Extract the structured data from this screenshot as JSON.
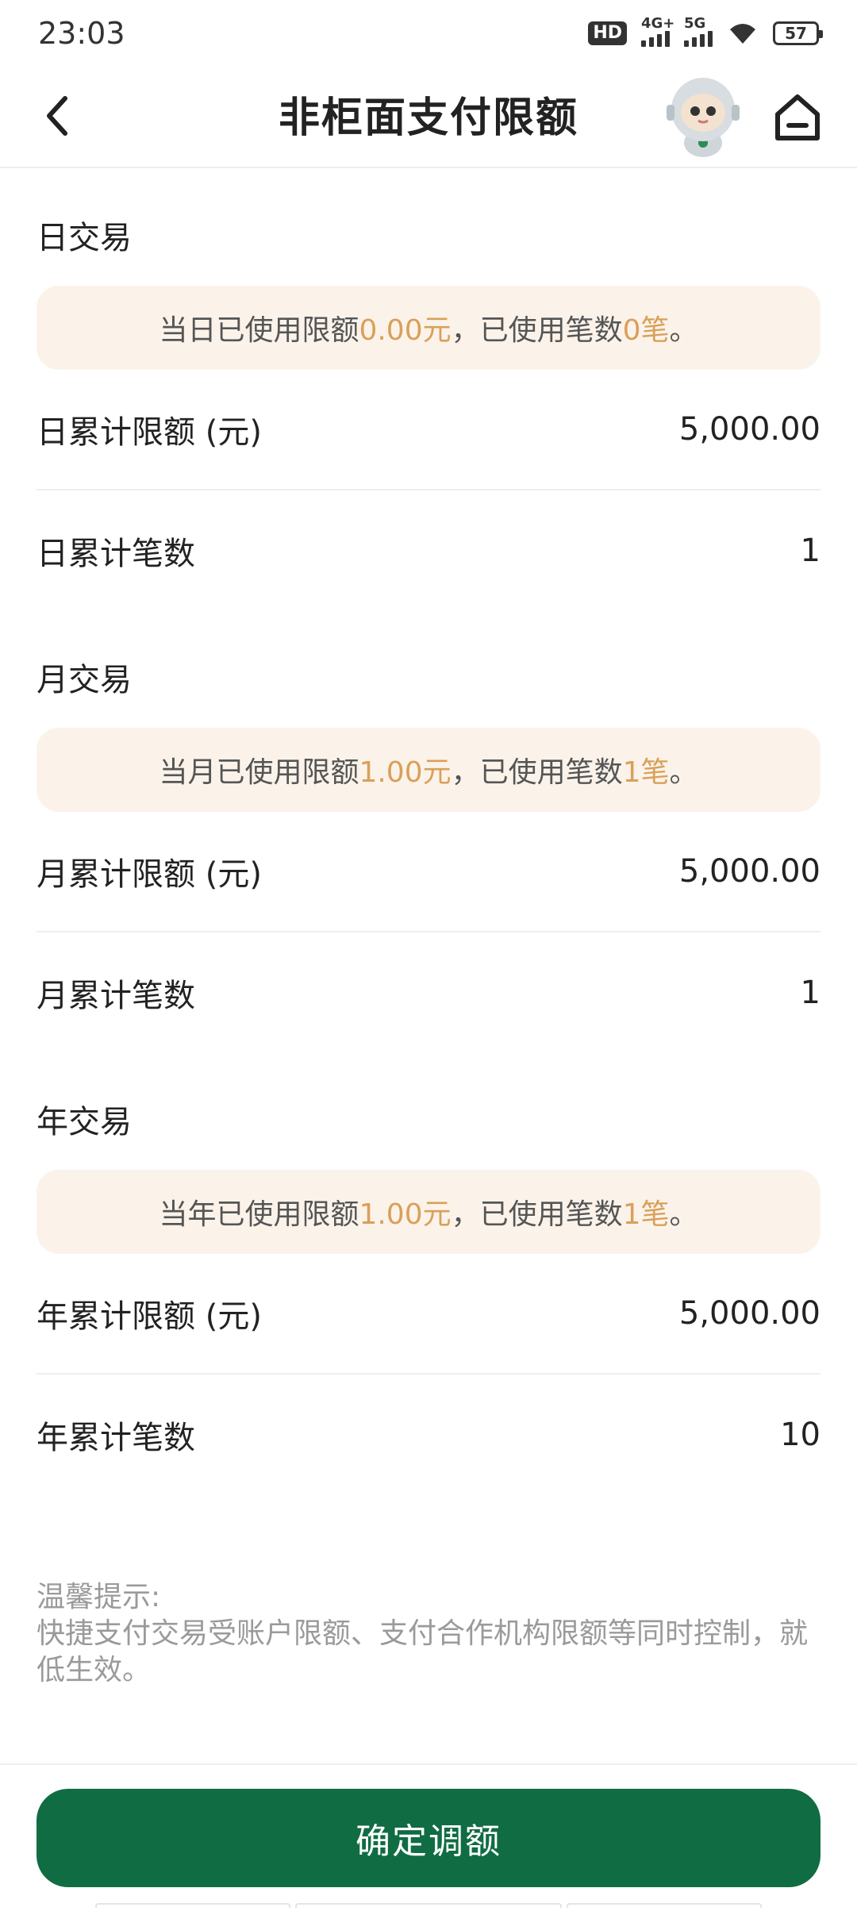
{
  "status_bar": {
    "time": "23:03",
    "hd_label": "HD",
    "sim1_label": "4G+",
    "sim2_label": "5G",
    "battery": "57"
  },
  "nav": {
    "title": "非柜面支付限额",
    "icons": [
      "back-arrow-icon",
      "robot-assistant-icon",
      "home-icon"
    ]
  },
  "day": {
    "title": "日交易",
    "notice_prefix": "当日已使用限额",
    "notice_amount": "0.00元",
    "notice_mid": "，已使用笔数",
    "notice_count": "0笔",
    "notice_suffix": "。",
    "limit_label": "日累计限额 (元)",
    "limit_value": "5,000.00",
    "count_label": "日累计笔数",
    "count_value": "1"
  },
  "month": {
    "title": "月交易",
    "notice_prefix": "当月已使用限额",
    "notice_amount": "1.00元",
    "notice_mid": "，已使用笔数",
    "notice_count": "1笔",
    "notice_suffix": "。",
    "limit_label": "月累计限额 (元)",
    "limit_value": "5,000.00",
    "count_label": "月累计笔数",
    "count_value": "1"
  },
  "year": {
    "title": "年交易",
    "notice_prefix": "当年已使用限额",
    "notice_amount": "1.00元",
    "notice_mid": "，已使用笔数",
    "notice_count": "1笔",
    "notice_suffix": "。",
    "limit_label": "年累计限额 (元)",
    "limit_value": "5,000.00",
    "count_label": "年累计笔数",
    "count_value": "10"
  },
  "tips": {
    "title": "温馨提示:",
    "body": "快捷支付交易受账户限额、支付合作机构限额等同时控制，就低生效。"
  },
  "footer": {
    "confirm_label": "确定调额"
  },
  "colors": {
    "primary_green": "#106c42",
    "highlight_orange": "#d9a05a",
    "notice_bg": "#fbf3ea"
  }
}
